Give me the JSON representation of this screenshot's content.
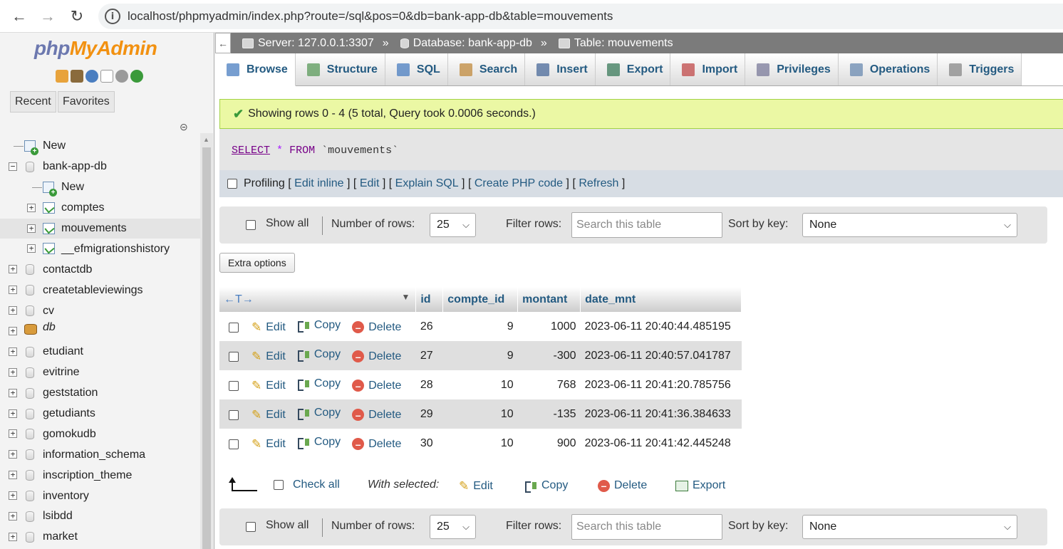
{
  "browser": {
    "back": "←",
    "forward": "→",
    "reload": "↻",
    "info": "i",
    "url": "localhost/phpmyadmin/index.php?route=/sql&pos=0&db=bank-app-db&table=mouvements"
  },
  "sidebar": {
    "logo_php": "php",
    "logo_myadmin": "MyAdmin",
    "recent": "Recent",
    "favorites": "Favorites",
    "tree": [
      {
        "label": "New",
        "kind": "new",
        "level": 0
      },
      {
        "label": "bank-app-db",
        "kind": "db",
        "level": 0,
        "expanded": true
      },
      {
        "label": "New",
        "kind": "new",
        "level": 1
      },
      {
        "label": "comptes",
        "kind": "table",
        "level": 1
      },
      {
        "label": "mouvements",
        "kind": "table",
        "level": 1,
        "selected": true
      },
      {
        "label": "__efmigrationshistory",
        "kind": "table",
        "level": 1
      },
      {
        "label": "contactdb",
        "kind": "db",
        "level": 0
      },
      {
        "label": "createtableviewings",
        "kind": "db",
        "level": 0
      },
      {
        "label": "cv",
        "kind": "db",
        "level": 0
      },
      {
        "label": "db",
        "kind": "db-special",
        "level": 0
      },
      {
        "label": "etudiant",
        "kind": "db",
        "level": 0
      },
      {
        "label": "evitrine",
        "kind": "db",
        "level": 0
      },
      {
        "label": "geststation",
        "kind": "db",
        "level": 0
      },
      {
        "label": "getudiants",
        "kind": "db",
        "level": 0
      },
      {
        "label": "gomokudb",
        "kind": "db",
        "level": 0
      },
      {
        "label": "information_schema",
        "kind": "db",
        "level": 0
      },
      {
        "label": "inscription_theme",
        "kind": "db",
        "level": 0
      },
      {
        "label": "inventory",
        "kind": "db",
        "level": 0
      },
      {
        "label": "lsibdd",
        "kind": "db",
        "level": 0
      },
      {
        "label": "market",
        "kind": "db",
        "level": 0
      }
    ]
  },
  "breadcrumb": {
    "server": "Server: 127.0.0.1:3307",
    "database": "Database: bank-app-db",
    "table": "Table: mouvements",
    "sep": "»"
  },
  "tabs": [
    {
      "label": "Browse",
      "icon": "browse-icon",
      "active": true
    },
    {
      "label": "Structure",
      "icon": "structure-icon"
    },
    {
      "label": "SQL",
      "icon": "sql-icon"
    },
    {
      "label": "Search",
      "icon": "search-icon"
    },
    {
      "label": "Insert",
      "icon": "insert-icon"
    },
    {
      "label": "Export",
      "icon": "export-icon"
    },
    {
      "label": "Import",
      "icon": "import-icon"
    },
    {
      "label": "Privileges",
      "icon": "privileges-icon"
    },
    {
      "label": "Operations",
      "icon": "operations-icon"
    },
    {
      "label": "Triggers",
      "icon": "triggers-icon"
    }
  ],
  "message": {
    "success": "Showing rows 0 - 4 (5 total, Query took 0.0006 seconds.)"
  },
  "sql": {
    "select": "SELECT",
    "star": "*",
    "from": "FROM",
    "table": "`mouvements`"
  },
  "profiling": {
    "label": "Profiling",
    "open": "[",
    "close": "]",
    "links": [
      "Edit inline",
      "Edit",
      "Explain SQL",
      "Create PHP code",
      "Refresh"
    ]
  },
  "navigation": {
    "show_all": "Show all",
    "number_of_rows_label": "Number of rows:",
    "number_of_rows": "25",
    "filter_label": "Filter rows:",
    "filter_placeholder": "Search this table",
    "sort_label": "Sort by key:",
    "sort_value": "None"
  },
  "extra_options": "Extra options",
  "table": {
    "sort_arrows": "←T→",
    "columns": [
      "id",
      "compte_id",
      "montant",
      "date_mnt"
    ],
    "actions": {
      "edit": "Edit",
      "copy": "Copy",
      "delete": "Delete"
    },
    "rows": [
      {
        "id": "26",
        "compte_id": "9",
        "montant": "1000",
        "date_mnt": "2023-06-11 20:40:44.485195"
      },
      {
        "id": "27",
        "compte_id": "9",
        "montant": "-300",
        "date_mnt": "2023-06-11 20:40:57.041787"
      },
      {
        "id": "28",
        "compte_id": "10",
        "montant": "768",
        "date_mnt": "2023-06-11 20:41:20.785756"
      },
      {
        "id": "29",
        "compte_id": "10",
        "montant": "-135",
        "date_mnt": "2023-06-11 20:41:36.384633"
      },
      {
        "id": "30",
        "compte_id": "10",
        "montant": "900",
        "date_mnt": "2023-06-11 20:41:42.445248"
      }
    ]
  },
  "bulk": {
    "check_all": "Check all",
    "with_selected": "With selected:",
    "edit": "Edit",
    "copy": "Copy",
    "delete": "Delete",
    "export": "Export"
  },
  "colors": {
    "link": "#235a81",
    "success_bg": "#ebf8a4",
    "crumb_bg": "#7b7b7b",
    "row_alt": "#dfdfdf"
  }
}
